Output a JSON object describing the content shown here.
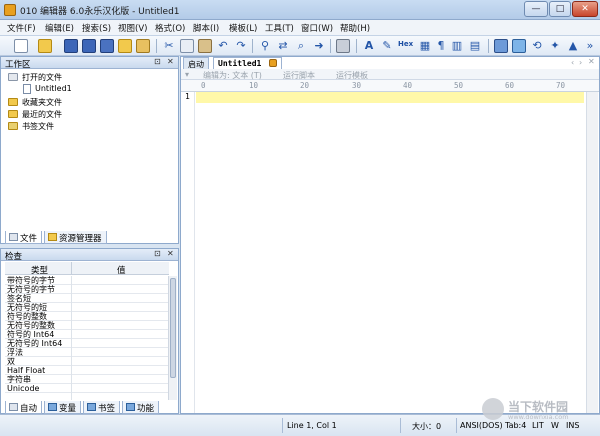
{
  "window": {
    "title": "010 编辑器 6.0永乐汉化版 - Untitled1",
    "min": "—",
    "max": "□",
    "close": "✕"
  },
  "menu": [
    "文件(F)",
    "编辑(E)",
    "搜索(S)",
    "视图(V)",
    "格式(O)",
    "脚本(I)",
    "模板(L)",
    "工具(T)",
    "窗口(W)",
    "帮助(H)"
  ],
  "toolbar": {
    "hex_label": "Hex"
  },
  "workspace": {
    "title": "工作区",
    "items": {
      "open_files": "打开的文件",
      "untitled": "Untitled1",
      "favorites": "收藏夹文件",
      "recent": "最近的文件",
      "bookmarks": "书签文件"
    },
    "tabs": {
      "files": "文件",
      "explorer": "资源管理器"
    }
  },
  "inspector": {
    "title": "检查",
    "col_type": "类型",
    "col_value": "值",
    "rows": [
      "带符号的字节",
      "无符号的字节",
      "签名短",
      "无符号的短",
      "符号的整数",
      "无符号的整数",
      "符号的 Int64",
      "无符号的 Int64",
      "浮法",
      "双",
      "Half Float",
      "字符串",
      "Unicode"
    ],
    "tabs": {
      "auto": "自动",
      "vars": "变量",
      "bookmarks": "书签",
      "functions": "功能"
    }
  },
  "editor": {
    "tab_start": "启动",
    "tab_file": "Untitled1",
    "edit_as": "编辑为: 文本 (T)",
    "run_script": "运行脚本",
    "run_template": "运行模板",
    "ruler": [
      "0",
      "10",
      "20",
      "30",
      "40",
      "50",
      "60",
      "70"
    ],
    "line_1": "1"
  },
  "status": {
    "position": "Line 1, Col 1",
    "size": "大小：0",
    "encoding": "ANSI(DOS)",
    "tab": "Tab:4",
    "endian": "LIT",
    "mode_w": "W",
    "mode_ins": "INS"
  },
  "watermark": {
    "text": "当下软件园",
    "sub": "www.downxia.com"
  }
}
